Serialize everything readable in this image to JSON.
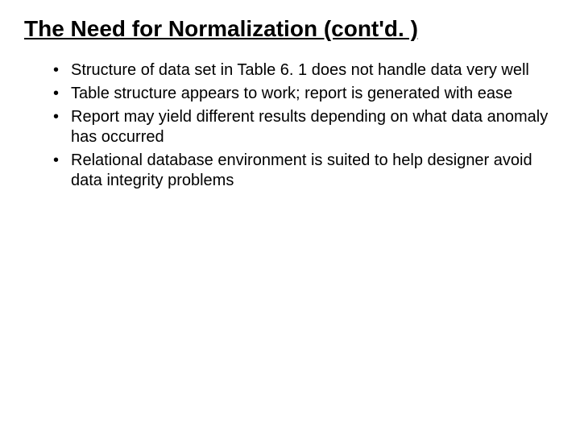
{
  "title": "The Need for Normalization (cont'd. )",
  "bullets": [
    "Structure of data set in Table 6. 1 does not handle data very well",
    "Table structure appears to work; report is generated with ease",
    "Report may yield different results depending on what data anomaly has occurred",
    "Relational database environment is suited to help designer avoid data integrity problems"
  ]
}
